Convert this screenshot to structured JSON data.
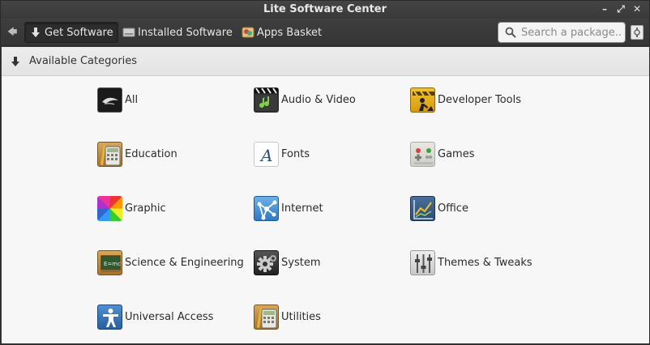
{
  "window": {
    "title": "Lite Software Center"
  },
  "toolbar": {
    "get_software": "Get Software",
    "installed_software": "Installed Software",
    "apps_basket": "Apps Basket"
  },
  "search": {
    "placeholder": "Search a package..."
  },
  "categories_header": "Available Categories",
  "categories": [
    {
      "name": "All",
      "icon": "all-icon"
    },
    {
      "name": "Audio & Video",
      "icon": "audio-video-icon"
    },
    {
      "name": "Developer Tools",
      "icon": "developer-tools-icon"
    },
    {
      "name": "Education",
      "icon": "education-icon"
    },
    {
      "name": "Fonts",
      "icon": "fonts-icon"
    },
    {
      "name": "Games",
      "icon": "games-icon"
    },
    {
      "name": "Graphic",
      "icon": "graphic-icon"
    },
    {
      "name": "Internet",
      "icon": "internet-icon"
    },
    {
      "name": "Office",
      "icon": "office-icon"
    },
    {
      "name": "Science & Engineering",
      "icon": "science-engineering-icon"
    },
    {
      "name": "System",
      "icon": "system-icon"
    },
    {
      "name": "Themes & Tweaks",
      "icon": "themes-tweaks-icon"
    },
    {
      "name": "Universal Access",
      "icon": "universal-access-icon"
    },
    {
      "name": "Utilities",
      "icon": "utilities-icon"
    }
  ]
}
